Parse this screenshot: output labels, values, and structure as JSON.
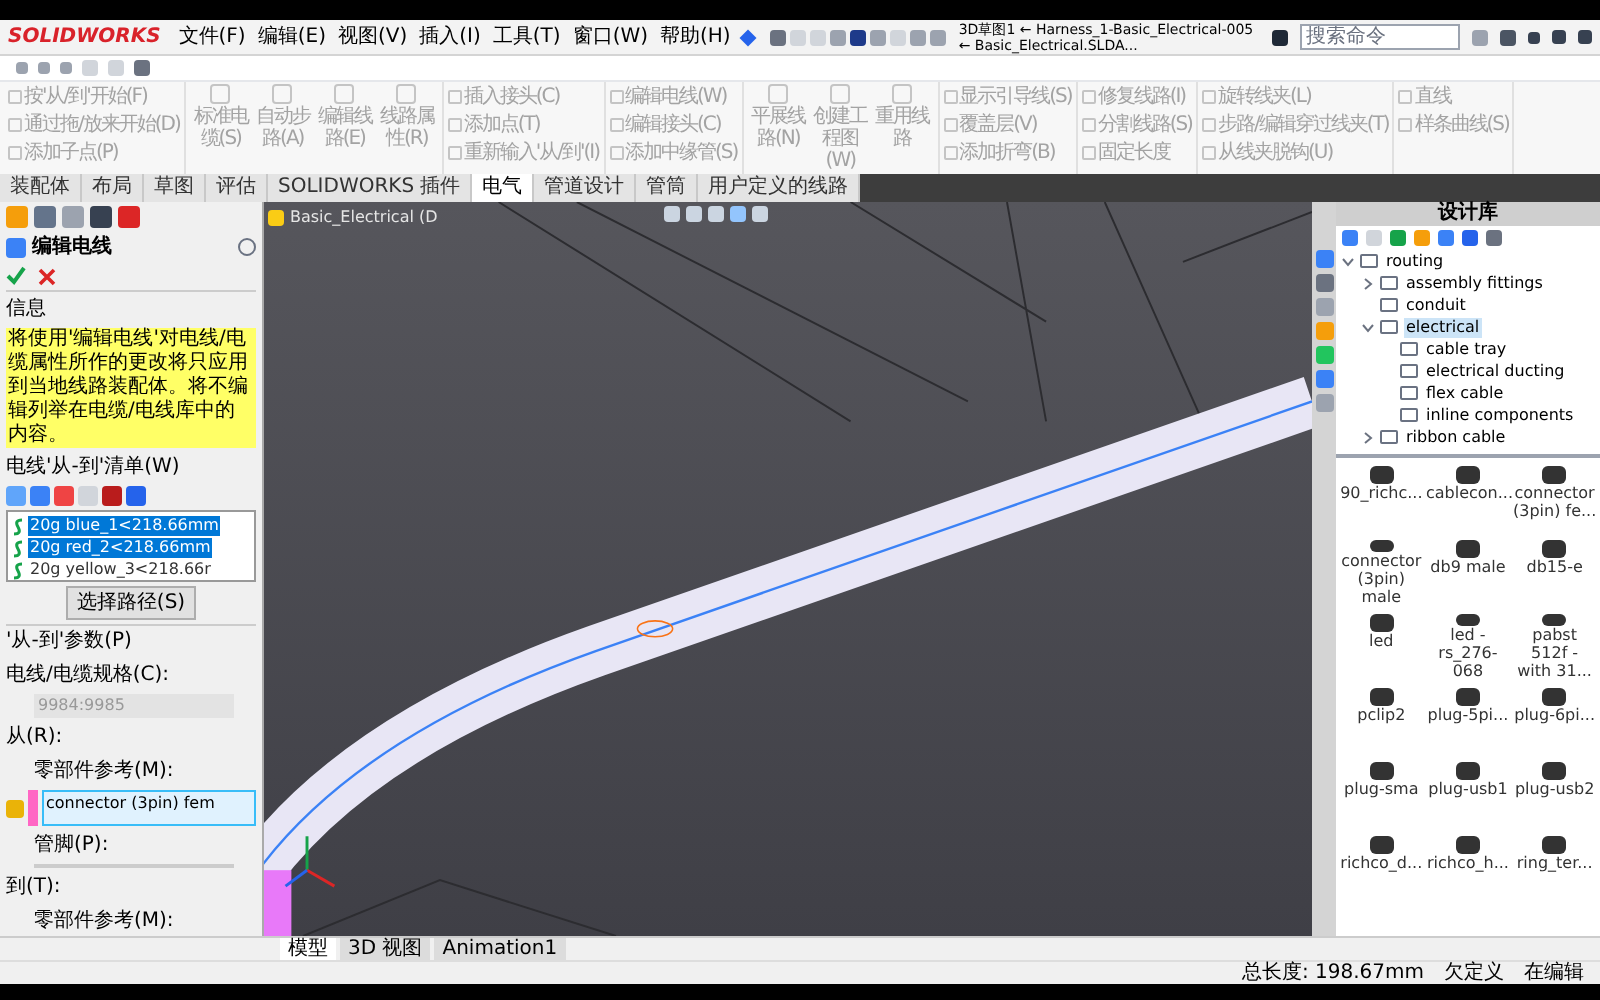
{
  "app": {
    "logo": "SOLIDWORKS",
    "menu": [
      "文件(F)",
      "编辑(E)",
      "视图(V)",
      "插入(I)",
      "工具(T)",
      "窗口(W)",
      "帮助(H)"
    ],
    "title": "3D草图1 ← Harness_1-Basic_Electrical-005 ← Basic_Electrical.SLDA...",
    "search": {
      "placeholder": "搜索命令"
    }
  },
  "ribbon": {
    "disabled": true,
    "groups": [
      {
        "kind": "small",
        "items": [
          "按'从/到'开始(F)",
          "通过拖/放来开始(D)",
          "添加子点(P)"
        ]
      },
      {
        "kind": "large",
        "items": [
          "标准电缆(S)",
          "自动步路(A)",
          "编辑线路(E)",
          "线路属性(R)"
        ]
      },
      {
        "kind": "small",
        "items": [
          "插入接头(C)",
          "添加点(T)",
          "重新输入'从/到'(I)"
        ]
      },
      {
        "kind": "small",
        "items": [
          "编辑电线(W)",
          "编辑接头(C)",
          "添加中缘管(S)"
        ]
      },
      {
        "kind": "large",
        "items": [
          "平展线路(N)",
          "创建工程图(W)",
          "重用线路"
        ]
      },
      {
        "kind": "small",
        "items": [
          "显示引导线(S)",
          "覆盖层(V)",
          "添加折弯(B)"
        ]
      },
      {
        "kind": "small",
        "items": [
          "修复线路(I)",
          "分割线路(S)",
          "固定长度"
        ]
      },
      {
        "kind": "small",
        "items": [
          "旋转线夹(L)",
          "步路/编辑穿过线夹(T)",
          "从线夹脱钩(U)"
        ]
      },
      {
        "kind": "small",
        "items": [
          "直线",
          "样条曲线(S)"
        ]
      }
    ]
  },
  "tabs": [
    {
      "label": "装配体",
      "selected": false
    },
    {
      "label": "布局",
      "selected": false
    },
    {
      "label": "草图",
      "selected": false
    },
    {
      "label": "评估",
      "selected": false
    },
    {
      "label": "SOLIDWORKS 插件",
      "selected": false
    },
    {
      "label": "电气",
      "selected": true
    },
    {
      "label": "管道设计",
      "selected": false
    },
    {
      "label": "管筒",
      "selected": false
    },
    {
      "label": "用户定义的线路",
      "selected": false
    }
  ],
  "property_manager": {
    "title": "编辑电线",
    "info": {
      "heading": "信息",
      "text": "将使用'编辑电线'对电线/电缆属性所作的更改将只应用到当地线路装配体。将不编辑列举在电缆/电线库中的内容。"
    },
    "wire_list": {
      "heading": "电线'从-到'清单(W)",
      "items": [
        {
          "label": "20g blue_1<218.66mm",
          "selected": true
        },
        {
          "label": "20g red_2<218.66mm",
          "selected": true
        },
        {
          "label": "20g yellow_3<218.66r",
          "selected": false
        }
      ],
      "button": "选择路径(S)"
    },
    "params": {
      "heading": "'从-到'参数(P)",
      "spec_label": "电线/电缆规格(C):",
      "spec_value": "9984:9985",
      "from_label": "从(R):",
      "ref_label": "零部件参考(M):",
      "ref_value": "connector (3pin) fem",
      "pin_label": "管脚(P):",
      "to_label": "到(T):",
      "to_ref_label": "零部件参考(M):"
    }
  },
  "viewport": {
    "document_tab": "Basic_Electrical (D"
  },
  "design_library": {
    "title": "设计库",
    "tree": [
      {
        "label": "routing",
        "expanded": true,
        "selected": false,
        "children": [
          {
            "label": "assembly fittings",
            "expanded": false,
            "selected": false
          },
          {
            "label": "conduit",
            "selected": false
          },
          {
            "label": "electrical",
            "expanded": true,
            "selected": true,
            "children": [
              {
                "label": "cable tray",
                "selected": false
              },
              {
                "label": "electrical ducting",
                "selected": false
              },
              {
                "label": "flex cable",
                "selected": false
              },
              {
                "label": "inline components",
                "selected": false
              }
            ]
          },
          {
            "label": "ribbon cable",
            "expanded": false,
            "selected": false
          }
        ]
      }
    ],
    "parts": [
      "90_richc...",
      "cablecon...",
      "connector (3pin) fe...",
      "connector (3pin) male",
      "db9 male",
      "db15-e",
      "led",
      "led - rs_276-068",
      "pabst 512f - with 31...",
      "pclip2",
      "plug-5pi...",
      "plug-6pi...",
      "plug-sma",
      "plug-usb1",
      "plug-usb2",
      "richco_d...",
      "richco_h...",
      "ring_ter..."
    ]
  },
  "bottom_tabs": [
    {
      "label": "模型",
      "selected": true
    },
    {
      "label": "3D 视图",
      "selected": false
    },
    {
      "label": "Animation1",
      "selected": false
    }
  ],
  "status_bar": [
    "总长度: 198.67mm",
    "欠定义",
    "在编辑"
  ]
}
